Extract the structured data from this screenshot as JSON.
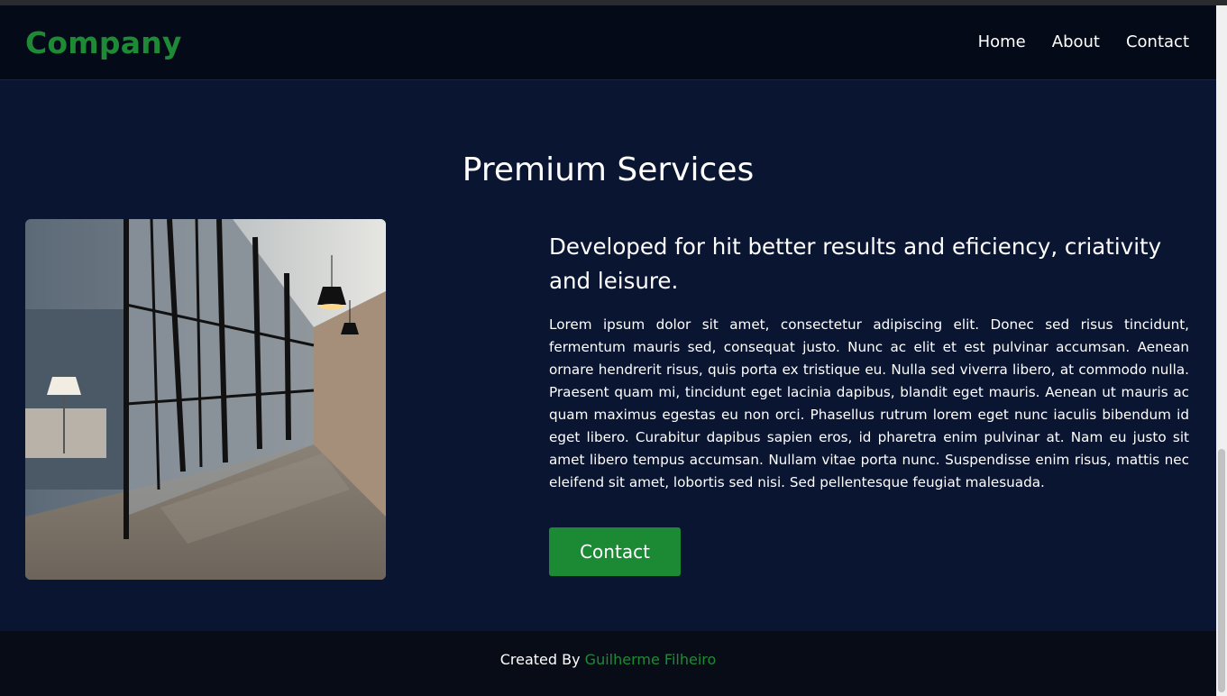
{
  "header": {
    "logo": "Company",
    "nav": [
      {
        "label": "Home"
      },
      {
        "label": "About"
      },
      {
        "label": "Contact"
      }
    ]
  },
  "main": {
    "title": "Premium Services",
    "image": {
      "icon": "office-hallway-photo"
    },
    "subtitle": "Developed for hit better results and eficiency, criativity and leisure.",
    "body": "Lorem ipsum dolor sit amet, consectetur adipiscing elit. Donec sed risus tincidunt, fermentum mauris sed, consequat justo. Nunc ac elit et est pulvinar accumsan. Aenean ornare hendrerit risus, quis porta ex tristique eu. Nulla sed viverra libero, at commodo nulla. Praesent quam mi, tincidunt eget lacinia dapibus, blandit eget mauris. Aenean ut mauris ac quam maximus egestas eu non orci. Phasellus rutrum lorem eget nunc iaculis bibendum id eget libero. Curabitur dapibus sapien eros, id pharetra enim pulvinar at. Nam eu justo sit amet libero tempus accumsan. Nullam vitae porta nunc. Suspendisse enim risus, mattis nec eleifend sit amet, lobortis sed nisi. Sed pellentesque feugiat malesuada.",
    "cta_label": "Contact"
  },
  "footer": {
    "prefix": "Created By",
    "author": "Guilherme Filheiro"
  },
  "colors": {
    "accent": "#1f8a35",
    "background": "#0a1532",
    "header_bg": "#050a18",
    "footer_bg": "#080c17"
  }
}
